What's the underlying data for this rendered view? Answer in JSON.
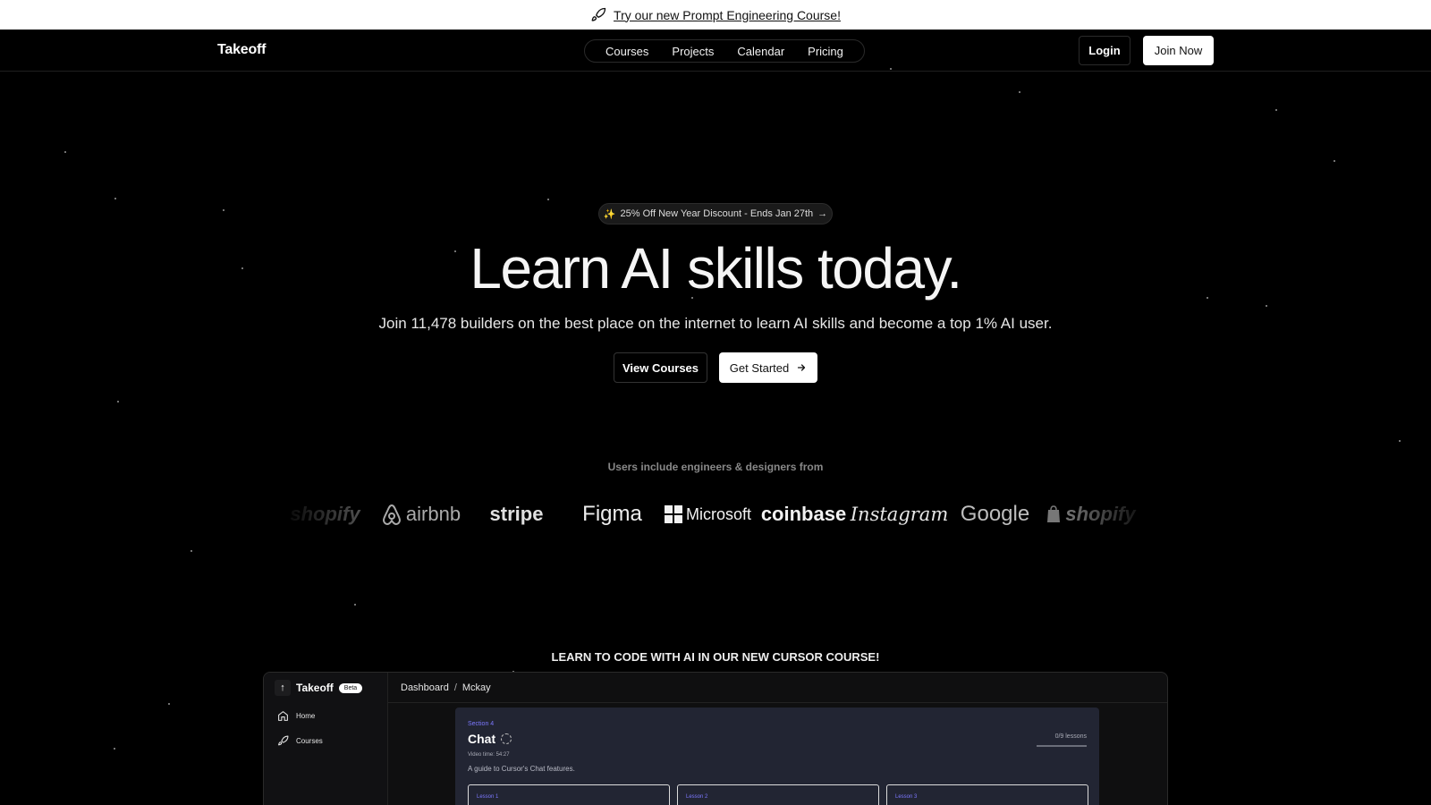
{
  "announcement": {
    "icon": "rocket-icon",
    "link_text": "Try our new Prompt Engineering Course!"
  },
  "nav": {
    "brand": "Takeoff",
    "links": [
      "Courses",
      "Projects",
      "Calendar",
      "Pricing"
    ],
    "login": "Login",
    "join": "Join Now"
  },
  "hero": {
    "promo": "25% Off New Year Discount - Ends Jan 27th",
    "promo_icon": "sparkle-icon",
    "title": "Learn AI skills today.",
    "subtitle": "Join 11,478 builders on the best place on the internet to learn AI skills and become a top 1% AI user.",
    "view_courses": "View Courses",
    "get_started": "Get Started"
  },
  "users": {
    "label": "Users include engineers & designers from",
    "logos": [
      "shopify",
      "airbnb",
      "stripe",
      "Figma",
      "Microsoft",
      "coinbase",
      "Instagram",
      "Google",
      "shopify"
    ]
  },
  "cursor_course": {
    "label": "LEARN TO CODE WITH AI IN OUR NEW CURSOR COURSE!"
  },
  "mockup": {
    "brand": "Takeoff",
    "badge": "Beta",
    "breadcrumb": [
      "Dashboard",
      "/",
      "Mckay"
    ],
    "sidebar": [
      {
        "label": "Home",
        "icon": "home-icon"
      },
      {
        "label": "Courses",
        "icon": "rocket-icon"
      }
    ],
    "card": {
      "section": "Section 4",
      "title": "Chat",
      "video_time": "Video time: 54:27",
      "description": "A guide to Cursor's Chat features.",
      "progress": "0/9 lessons",
      "lessons": [
        "Lesson 1",
        "Lesson 2",
        "Lesson 3"
      ]
    }
  },
  "colors": {
    "background": "#000000",
    "accent_purple": "#7c78ff",
    "card_bg": "#222533"
  }
}
